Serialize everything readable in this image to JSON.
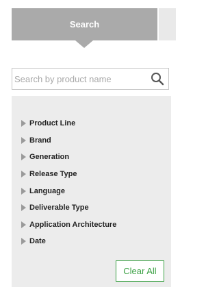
{
  "tabs": {
    "active_label": "Search"
  },
  "search": {
    "placeholder": "Search by product name",
    "value": ""
  },
  "filters": {
    "items": [
      {
        "label": "Product Line"
      },
      {
        "label": "Brand"
      },
      {
        "label": "Generation"
      },
      {
        "label": "Release Type"
      },
      {
        "label": "Language"
      },
      {
        "label": "Deliverable Type"
      },
      {
        "label": "Application Architecture"
      },
      {
        "label": "Date"
      }
    ],
    "clear_label": "Clear All"
  },
  "colors": {
    "tab_active": "#aaaaaa",
    "panel_bg": "#ececec",
    "clear_accent": "#3aa043"
  }
}
